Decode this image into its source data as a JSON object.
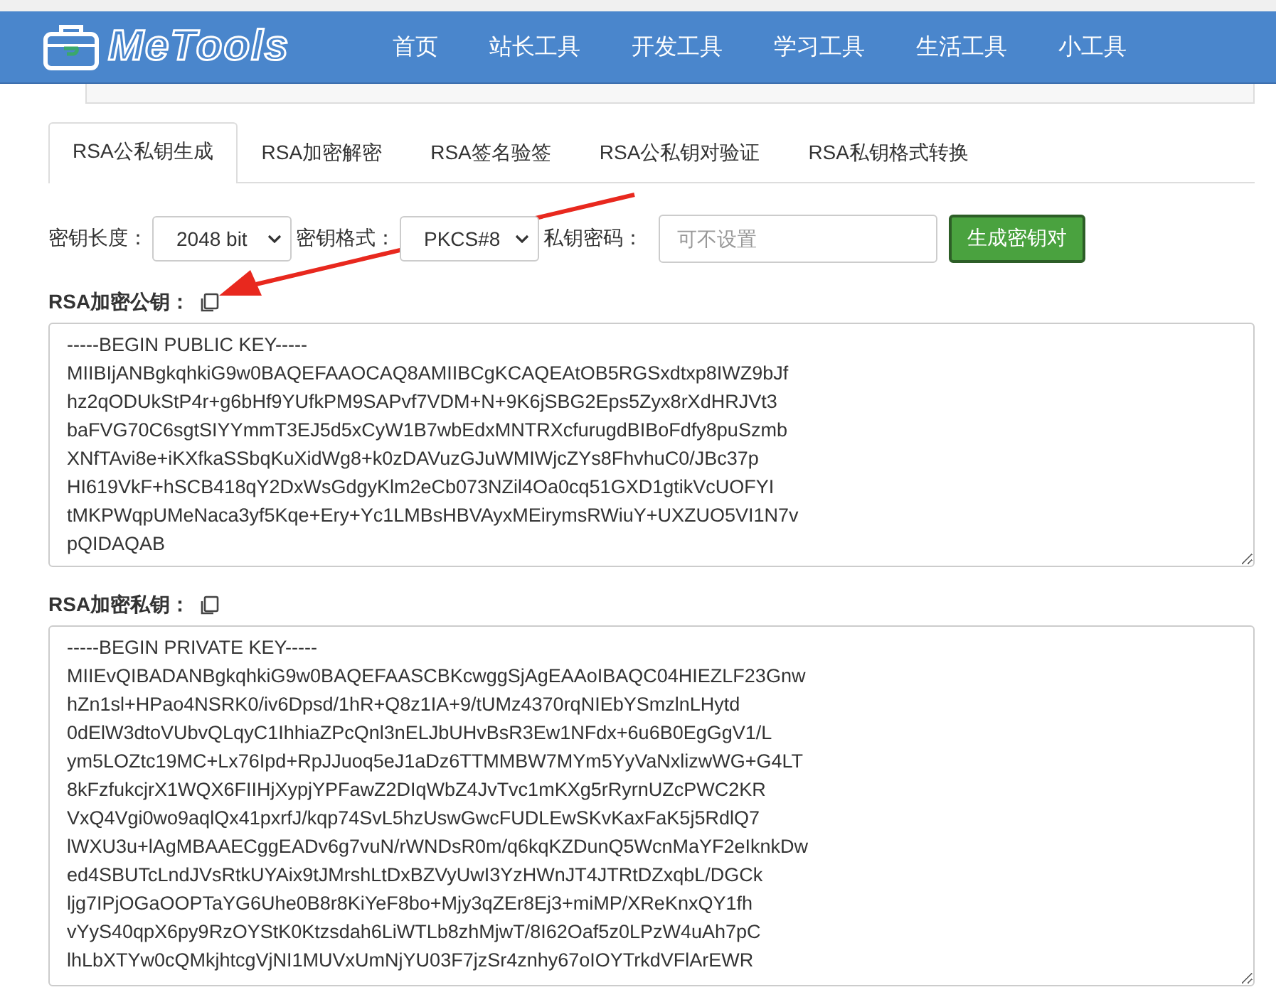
{
  "header": {
    "logo_text": "MeTools",
    "nav": [
      {
        "label": "首页"
      },
      {
        "label": "站长工具"
      },
      {
        "label": "开发工具"
      },
      {
        "label": "学习工具"
      },
      {
        "label": "生活工具"
      },
      {
        "label": "小工具"
      }
    ]
  },
  "tabs": [
    {
      "label": "RSA公私钥生成",
      "selected": true
    },
    {
      "label": "RSA加密解密",
      "selected": false
    },
    {
      "label": "RSA签名验签",
      "selected": false
    },
    {
      "label": "RSA公私钥对验证",
      "selected": false
    },
    {
      "label": "RSA私钥格式转换",
      "selected": false
    }
  ],
  "form": {
    "key_length_label": "密钥长度：",
    "key_length": "2048 bit",
    "key_format_label": "密钥格式：",
    "key_format": "PKCS#8",
    "password_label": "私钥密码：",
    "password_placeholder": "可不设置",
    "generate_button": "生成密钥对"
  },
  "public_key": {
    "label": "RSA加密公钥：",
    "lines": [
      "-----BEGIN PUBLIC KEY-----",
      "MIIBIjANBgkqhkiG9w0BAQEFAAOCAQ8AMIIBCgKCAQEAtOB5RGSxdtxp8IWZ9bJf",
      "hz2qODUkStP4r+g6bHf9YUfkPM9SAPvf7VDM+N+9K6jSBG2Eps5Zyx8rXdHRJVt3",
      "baFVG70C6sgtSIYYmmT3EJ5d5xCyW1B7wbEdxMNTRXcfurugdBIBoFdfy8puSzmb",
      "XNfTAvi8e+iKXfkaSSbqKuXidWg8+k0zDAVuzGJuWMIWjcZYs8FhvhuC0/JBc37p",
      "HI619VkF+hSCB418qY2DxWsGdgyKlm2eCb073NZil4Oa0cq51GXD1gtikVcUOFYI",
      "tMKPWqpUMeNaca3yf5Kqe+Ery+Yc1LMBsHBVAyxMEirymsRWiuY+UXZUO5VI1N7v",
      "pQIDAQAB"
    ]
  },
  "private_key": {
    "label": "RSA加密私钥：",
    "lines": [
      "-----BEGIN PRIVATE KEY-----",
      "MIIEvQIBADANBgkqhkiG9w0BAQEFAASCBKcwggSjAgEAAoIBAQC04HIEZLF23Gnw",
      "hZn1sl+HPao4NSRK0/iv6Dpsd/1hR+Q8z1IA+9/tUMz4370rqNIEbYSmzlnLHytd",
      "0dElW3dtoVUbvQLqyC1IhhiaZPcQnl3nELJbUHvBsR3Ew1NFdx+6u6B0EgGgV1/L",
      "ym5LOZtc19MC+Lx76Ipd+RpJJuoq5eJ1aDz6TTMMBW7MYm5YyVaNxlizwWG+G4LT",
      "8kFzfukcjrX1WQX6FIIHjXypjYPFawZ2DIqWbZ4JvTvc1mKXg5rRyrnUZcPWC2KR",
      "VxQ4Vgi0wo9aqlQx41pxrfJ/kqp74SvL5hzUswGwcFUDLEwSKvKaxFaK5j5RdlQ7",
      "lWXU3u+lAgMBAAECggEADv6g7vuN/rWNDsR0m/q6kqKZDunQ5WcnMaYF2eIknkDw",
      "ed4SBUTcLndJVsRtkUYAix9tJMrshLtDxBZVyUwI3YzHWnJT4JTRtDZxqbL/DGCk",
      "ljg7IPjOGaOOPTaYG6Uhe0B8r8KiYeF8bo+Mjy3qZEr8Ej3+miMP/XReKnxQY1fh",
      "vYyS40qpX6py9RzOYStK0Ktzsdah6LiWTLb8zhMjwT/8I62Oaf5z0LPzW4uAh7pC",
      "lhLbXTYw0cQMkjhtcgVjNI1MUVxUmNjYU03F7jzSr4znhy67oIOYTrkdVFlArEWR"
    ]
  }
}
